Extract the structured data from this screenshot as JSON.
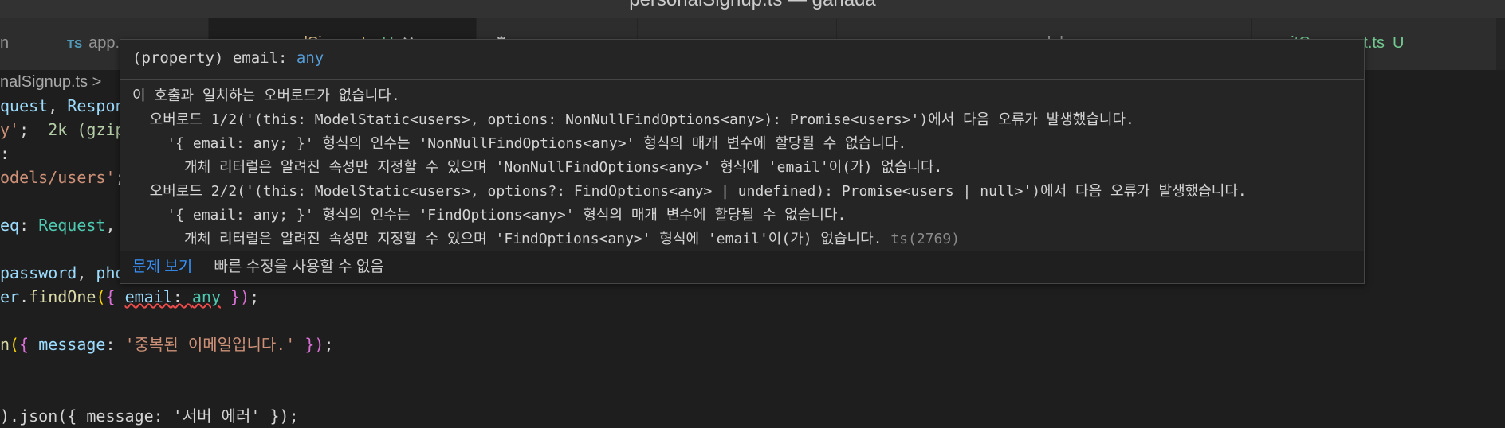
{
  "window": {
    "title": "personalSignup.ts — ganada"
  },
  "tabs": [
    {
      "label": "n",
      "badge": ""
    },
    {
      "label": "app.",
      "badge": "TS"
    },
    {
      "label": "personalSignup.ts",
      "badge": "TS",
      "git": "U",
      "active": true
    },
    {
      "label": "",
      "badge": ""
    },
    {
      "label": "m",
      "badge": "TS"
    },
    {
      "label": "u",
      "badge": "TS"
    },
    {
      "label": "dele",
      "badge": "TS"
    },
    {
      "label": "itComment.ts",
      "badge": "TS",
      "git": "U"
    }
  ],
  "breadcrumb": {
    "file": "nalSignup.ts",
    "sep": ">"
  },
  "code": {
    "l1_req": "quest",
    "l1_comma": ", ",
    "l1_res": "Respon",
    "l2_str": "y'",
    "l2_semi": ";",
    "l2_size": "2k (gzip",
    "l3_dot": ":",
    "l4_path": "odels/users'",
    "l4_semi": ";",
    "l5_param": "eq",
    "l5_colon": ": ",
    "l5_type": "Request",
    "l5_comma": ",",
    "l6_a": "password",
    "l6_comma": ", ",
    "l6_b": "pho",
    "l7_obj": "er",
    "l7_dot": ".",
    "l7_fn": "findOne",
    "l7_open": "(",
    "l7_brace": "{ ",
    "l7_key": "email",
    "l7_col": ": ",
    "l7_any": "any",
    "l7_close": " })",
    "l7_semi": ";",
    "l8_fn": "n",
    "l8_open": "(",
    "l8_brace": "{ ",
    "l8_key": "message",
    "l8_col": ": ",
    "l8_str": "'중복된 이메일입니다.'",
    "l8_close": " })",
    "l8_semi": ";",
    "l9_text": ").json({ message: '서버 에러' });"
  },
  "hover": {
    "sig_prefix": "(property) email: ",
    "sig_type": "any",
    "lines": [
      "이 호출과 일치하는 오버로드가 없습니다.",
      "  오버로드 1/2('(this: ModelStatic<users>, options: NonNullFindOptions<any>): Promise<users>')에서 다음 오류가 발생했습니다.",
      "    '{ email: any; }' 형식의 인수는 'NonNullFindOptions<any>' 형식의 매개 변수에 할당될 수 없습니다.",
      "      개체 리터럴은 알려진 속성만 지정할 수 있으며 'NonNullFindOptions<any>' 형식에 'email'이(가) 없습니다.",
      "  오버로드 2/2('(this: ModelStatic<users>, options?: FindOptions<any> | undefined): Promise<users | null>')에서 다음 오류가 발생했습니다.",
      "    '{ email: any; }' 형식의 인수는 'FindOptions<any>' 형식의 매개 변수에 할당될 수 없습니다.",
      "      개체 리터럴은 알려진 속성만 지정할 수 있으며 'FindOptions<any>' 형식에 'email'이(가) 없습니다. "
    ],
    "error_code": "ts(2769)",
    "view_problem": "문제 보기",
    "no_quick_fix": "빠른 수정을 사용할 수 없음"
  }
}
